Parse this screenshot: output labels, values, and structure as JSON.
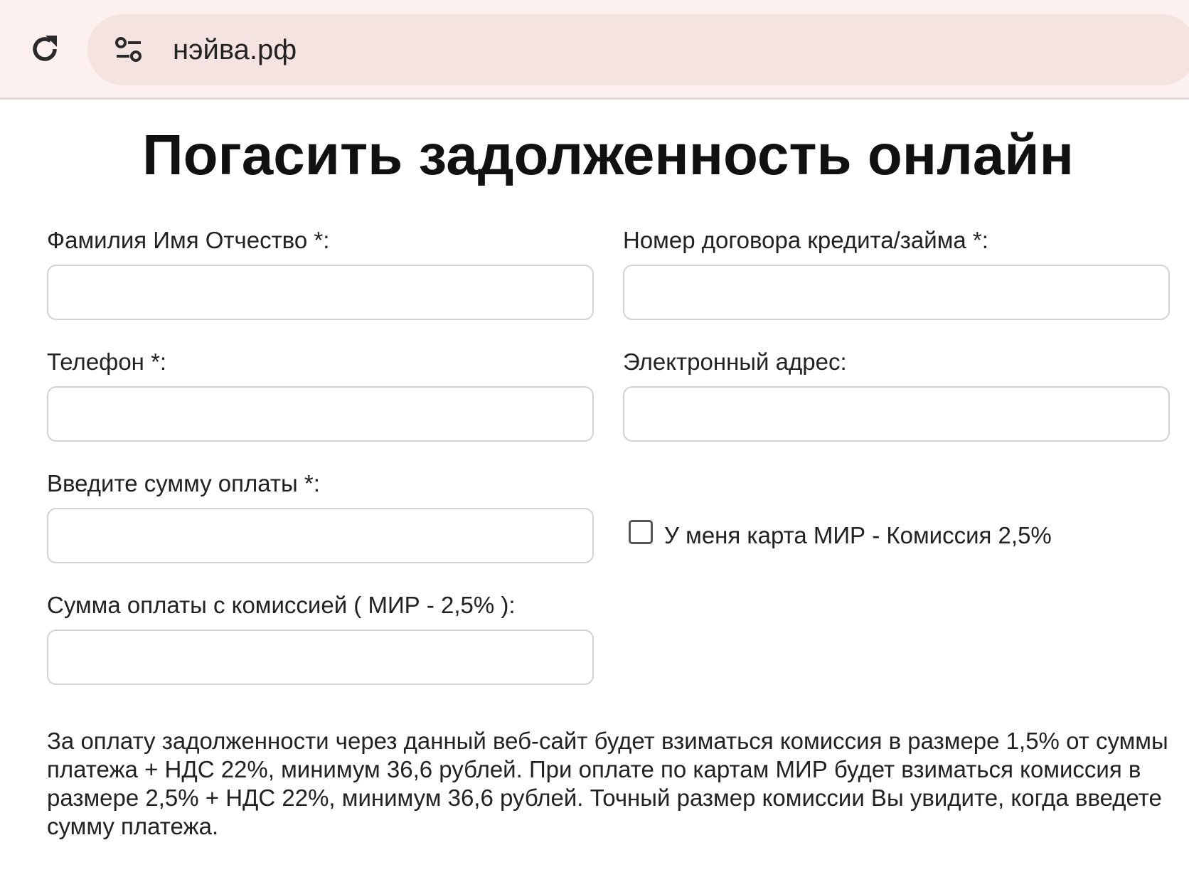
{
  "browser": {
    "url": "нэйва.рф"
  },
  "page": {
    "title": "Погасить задолженность онлайн"
  },
  "form": {
    "fio": {
      "label": "Фамилия Имя Отчество *:",
      "value": ""
    },
    "contract": {
      "label": "Номер договора кредита/займа *:",
      "value": ""
    },
    "phone": {
      "label": "Телефон *:",
      "value": ""
    },
    "email": {
      "label": "Электронный адрес:",
      "value": ""
    },
    "amount": {
      "label": "Введите сумму оплаты *:",
      "value": ""
    },
    "mir_card": {
      "label": "У меня карта МИР - Комиссия 2,5%",
      "checked": false
    },
    "amount_with_fee": {
      "label": "Сумма оплаты с комиссией ( МИР - 2,5% ):",
      "value": ""
    }
  },
  "note": "За оплату задолженности через данный веб-сайт будет взиматься комиссия в размере 1,5% от суммы платежа + НДС 22%, минимум 36,6 рублей. При оплате по картам МИР будет взиматься комиссия в размере 2,5% + НДС 22%, минимум 36,6 рублей. Точный размер комиссии Вы увидите, когда введете сумму платежа.",
  "icons": {
    "reload": "reload-icon",
    "site_info": "tune-icon"
  },
  "colors": {
    "toolbar_bg": "#fcf1ef",
    "urlbar_bg": "#f5e3e1",
    "input_border": "#d3d3d3"
  }
}
